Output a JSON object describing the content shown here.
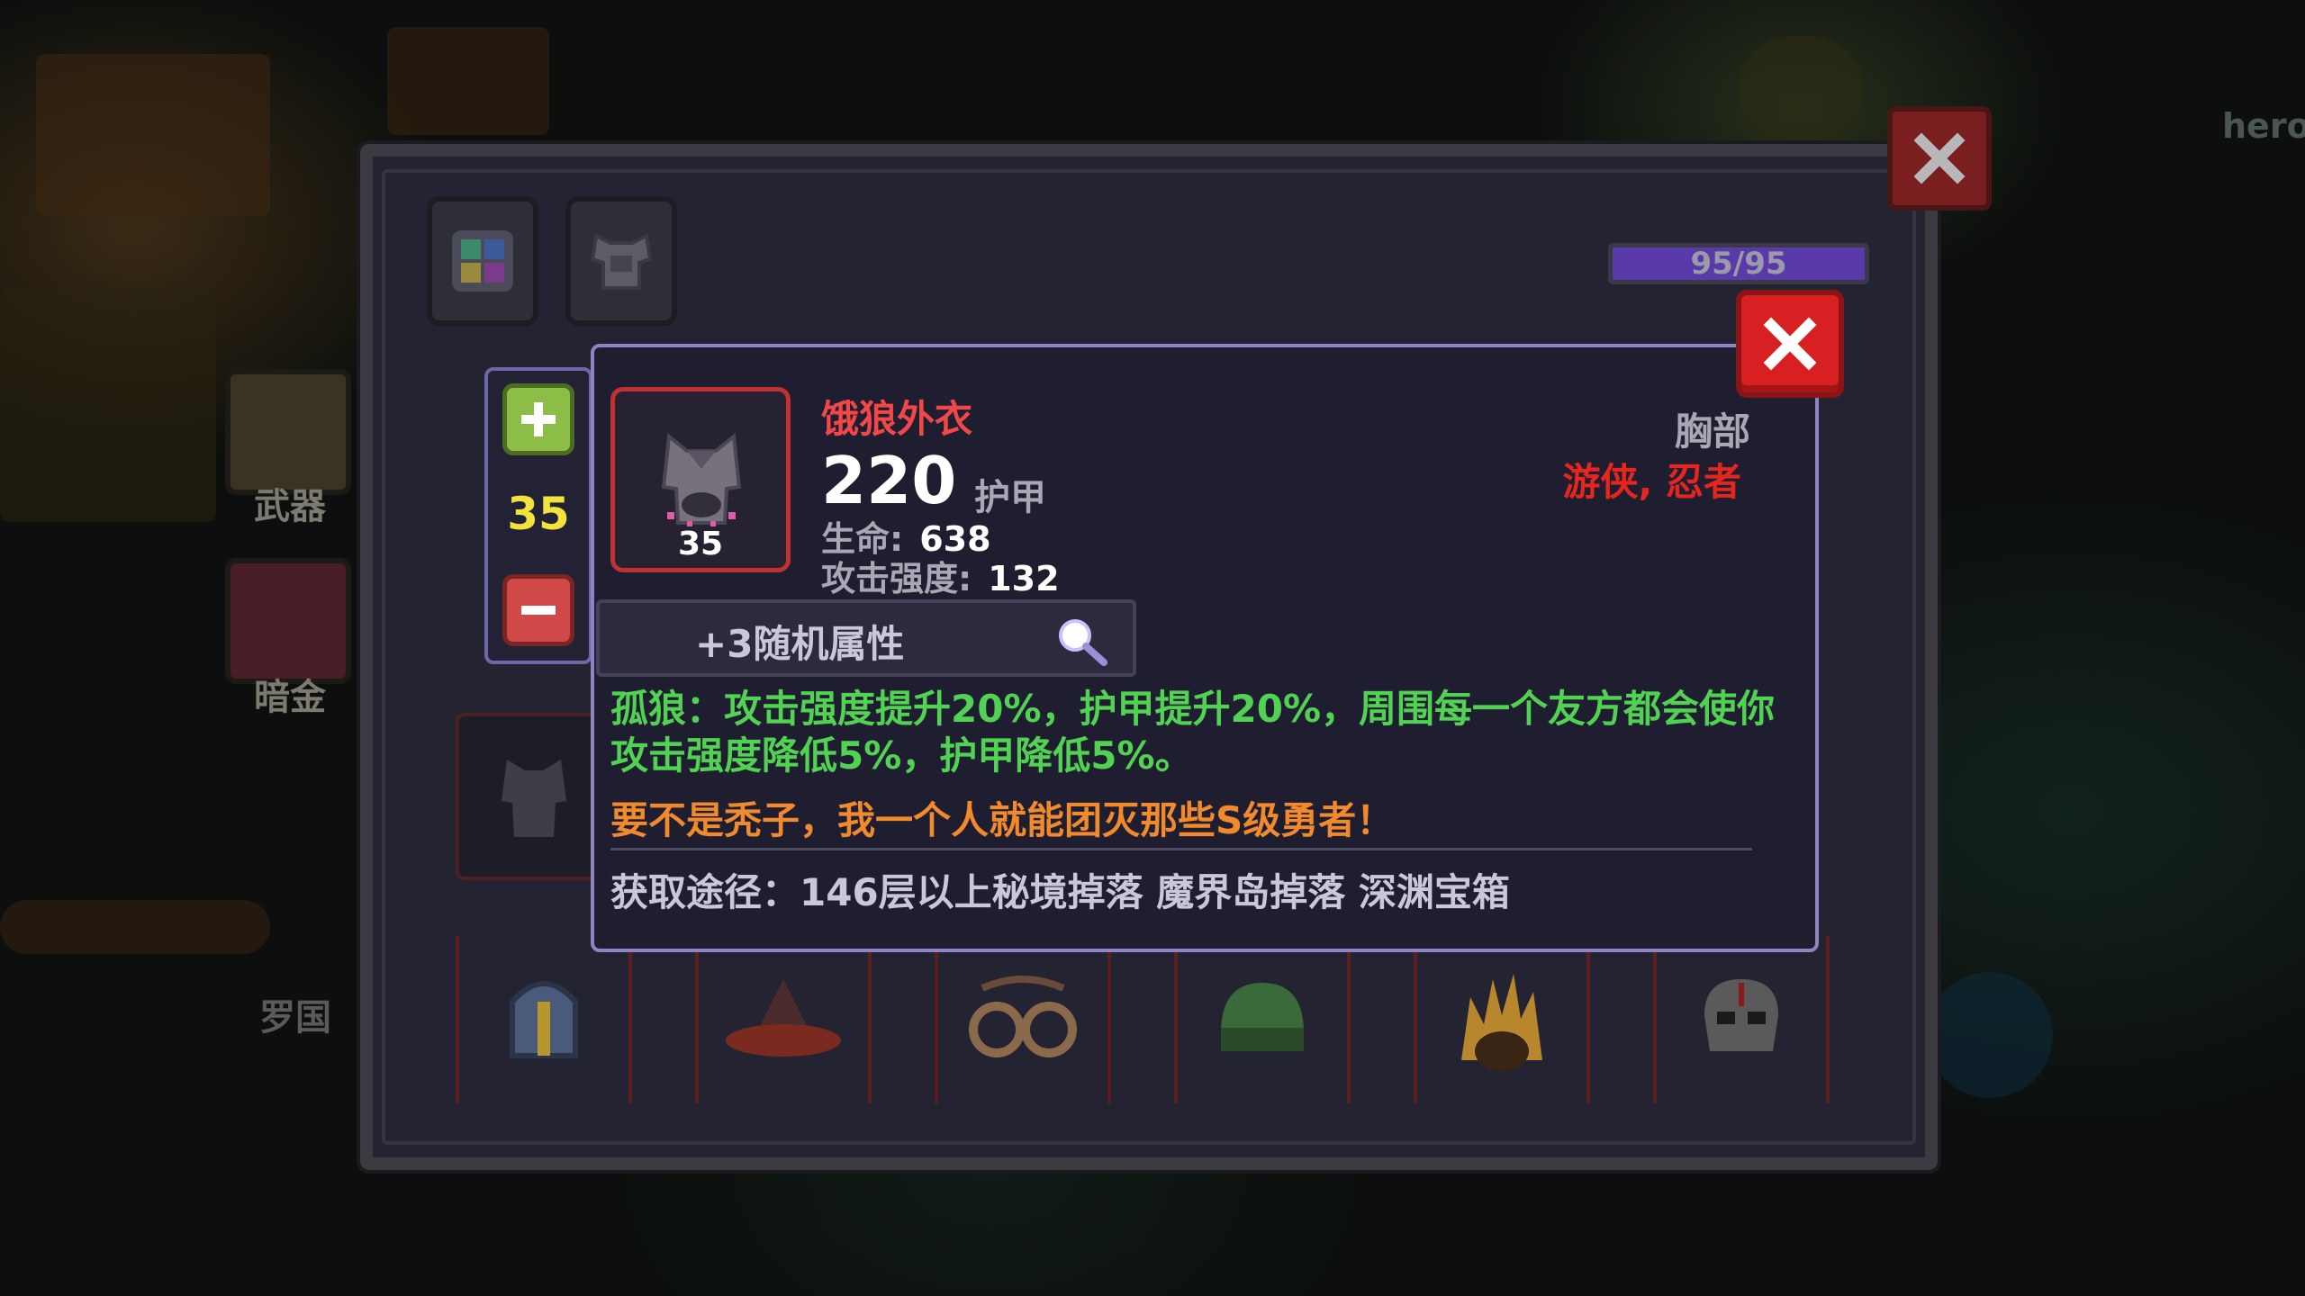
{
  "background": {
    "hero_label": "hero",
    "weapon_label": "武器",
    "dark_gold_label": "暗金",
    "bg_name": "罗国"
  },
  "panel": {
    "hp_text": "95/95",
    "hp_fraction": 1.0,
    "tabs": [
      "grid-icon",
      "armor-icon"
    ]
  },
  "stepper": {
    "value": "35"
  },
  "item": {
    "name": "饿狼外衣",
    "level": "35",
    "armor": "220",
    "armor_label": "护甲",
    "stats": [
      {
        "label": "生命:",
        "value": "638"
      },
      {
        "label": "攻击强度:",
        "value": "132"
      }
    ],
    "slot": "胸部",
    "classes": "游侠, 忍者",
    "random_attr": "+3随机属性",
    "effect": "孤狼：攻击强度提升20%，护甲提升20%，周围每一个友方都会使你攻击强度降低5%，护甲降低5%。",
    "flavor": "要不是秃子，我一个人就能团灭那些S级勇者！",
    "source": "获取途径：146层以上秘境掉落 魔界岛掉落 深渊宝箱"
  },
  "colors": {
    "item_name": "#f04848",
    "classes": "#e5261e",
    "effect": "#52d252",
    "flavor": "#f08a2c",
    "stepper_value": "#f4e23c"
  }
}
